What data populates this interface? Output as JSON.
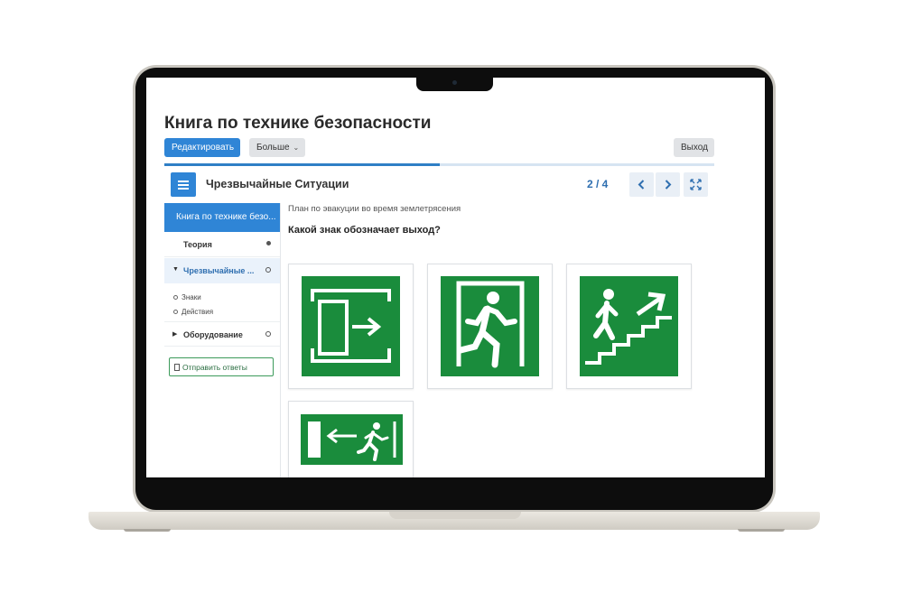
{
  "page": {
    "title": "Книга по технике безопасности",
    "buttons": {
      "edit": "Редактировать",
      "more": "Больше",
      "exit": "Выход"
    },
    "progress_fraction": 0.5
  },
  "course_bar": {
    "section_title": "Чрезвычайные Ситуации",
    "pager": "2 / 4"
  },
  "sidebar": {
    "header": "Книга по технике безо...",
    "items": [
      {
        "label": "Теория",
        "status": "completed"
      },
      {
        "label": "Чрезвычайные ...",
        "status": "incomplete",
        "expanded": true,
        "subitems": [
          "Знаки",
          "Действия"
        ]
      },
      {
        "label": "Оборудование",
        "status": "incomplete",
        "expanded": false
      }
    ],
    "submit_label": "Отправить ответы"
  },
  "content": {
    "header": "План по эвакуции во время землетрясения",
    "question": "Какой знак обозначает выход?",
    "answers": [
      {
        "icon": "door-arrow-sign-icon"
      },
      {
        "icon": "running-man-exit-door-icon"
      },
      {
        "icon": "person-up-stairs-icon"
      },
      {
        "icon": "exit-arrow-left-running-man-icon"
      }
    ],
    "sign_color": "#1a8c3c"
  }
}
